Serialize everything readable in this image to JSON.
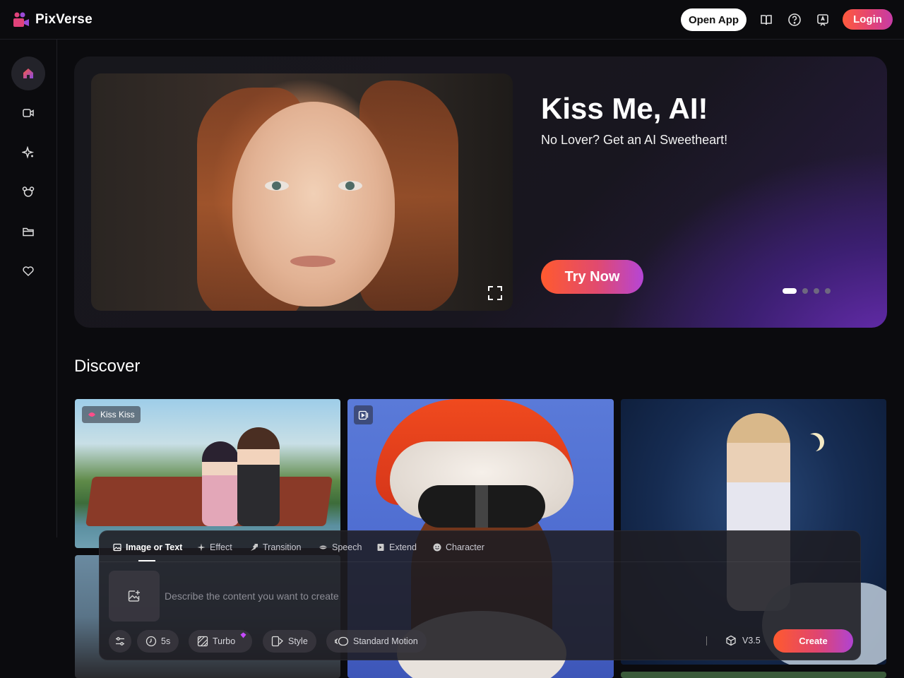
{
  "app": {
    "name": "PixVerse"
  },
  "header": {
    "open_app_label": "Open App",
    "icons": [
      "book-icon",
      "help-icon",
      "feedback-icon"
    ],
    "login_label": "Login"
  },
  "sidebar": {
    "items": [
      {
        "icon": "home-icon",
        "active": true
      },
      {
        "icon": "video-icon",
        "active": false
      },
      {
        "icon": "sparkle-icon",
        "active": false
      },
      {
        "icon": "mascot-icon",
        "active": false
      },
      {
        "icon": "folder-icon",
        "active": false
      },
      {
        "icon": "heart-icon",
        "active": false
      }
    ]
  },
  "hero": {
    "title": "Kiss Me, AI!",
    "subtitle": "No Lover? Get an AI Sweetheart!",
    "cta_label": "Try Now",
    "slides_total": 4,
    "active_slide": 1
  },
  "discover": {
    "title": "Discover",
    "cards": [
      {
        "badge": "Kiss Kiss",
        "badge_icon": "kiss-icon"
      },
      {
        "badge_icon": "video-clip-icon"
      },
      {},
      {},
      {}
    ]
  },
  "composer": {
    "tabs": [
      {
        "label": "Image or Text",
        "icon": "image-icon",
        "active": true
      },
      {
        "label": "Effect",
        "icon": "sparkle-icon"
      },
      {
        "label": "Transition",
        "icon": "transition-icon"
      },
      {
        "label": "Speech",
        "icon": "lips-icon"
      },
      {
        "label": "Extend",
        "icon": "extend-icon"
      },
      {
        "label": "Character",
        "icon": "smile-icon"
      }
    ],
    "prompt_placeholder": "Describe the content you want to create",
    "chips": {
      "duration": "5s",
      "turbo": "Turbo",
      "style": "Style",
      "motion": "Standard Motion"
    },
    "separator": "|",
    "version": "V3.5",
    "create_label": "Create"
  },
  "colors": {
    "accent_gradient_start": "#ff5a2e",
    "accent_gradient_end": "#b043d2",
    "background": "#0b0b0e"
  }
}
